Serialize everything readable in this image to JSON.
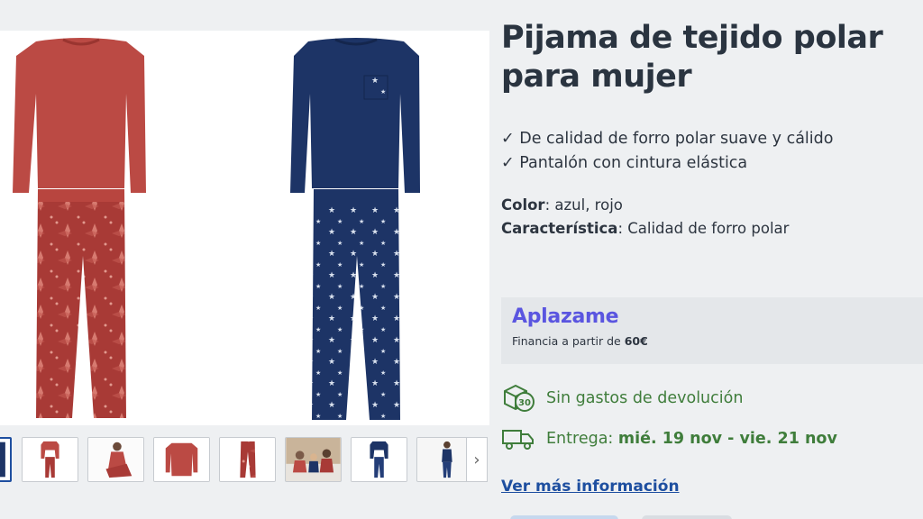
{
  "product": {
    "title": "Pijama de tejido polar para mujer",
    "features": [
      "De calidad de forro polar suave y cálido",
      "Pantalón con cintura elástica"
    ],
    "specs": {
      "color_label": "Color",
      "color_value": ": azul, rojo",
      "feature_label": "Característica",
      "feature_value": ": Calidad de forro polar"
    }
  },
  "financing": {
    "brand": "Aplazame",
    "text_prefix": "Financia a partir de ",
    "amount": "60€"
  },
  "shipping": {
    "returns_text": "Sin gastos de devolución",
    "returns_badge": "30",
    "delivery_label": "Entrega: ",
    "delivery_dates": "mié. 19 nov - vie. 21 nov"
  },
  "more_info_link": "Ver más información",
  "gallery": {
    "next_arrow": "›",
    "thumbnails": [
      "navy-pajama-partial",
      "red-pajama-set",
      "woman-red-pajama",
      "red-top",
      "red-pants",
      "family-photo",
      "navy-pajama-set",
      "woman-navy-pajama"
    ],
    "active_index": 0
  },
  "colors": {
    "title": "#2a3440",
    "link": "#1e4fa0",
    "shipping_green": "#3f7d3b",
    "aplazame_purple": "#5a55e0",
    "red_fabric": "#b8453f",
    "navy_fabric": "#1d3466"
  }
}
